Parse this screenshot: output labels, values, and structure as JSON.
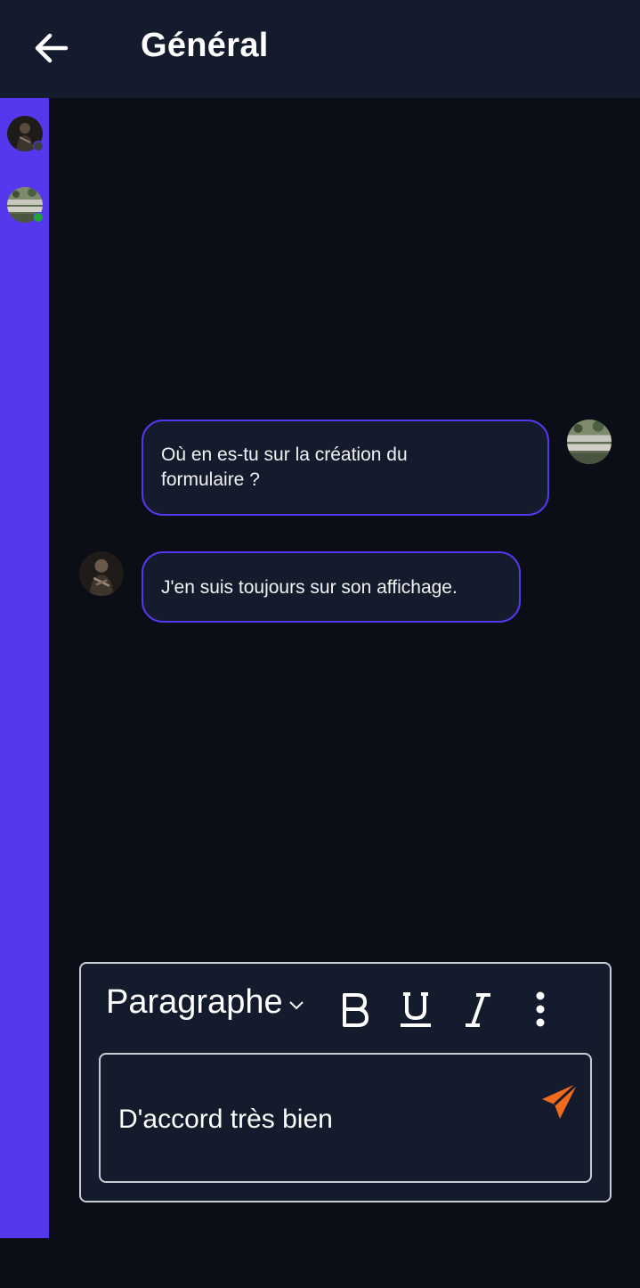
{
  "header": {
    "title": "Général",
    "back_icon": "arrow-left-icon"
  },
  "sidebar": {
    "users": [
      {
        "avatar": "user-photo-dark",
        "status": "offline",
        "status_color": "#3a3f4b"
      },
      {
        "avatar": "user-photo-garden",
        "status": "online",
        "status_color": "#1fa33a"
      }
    ]
  },
  "messages": [
    {
      "side": "right",
      "avatar": "user-photo-garden",
      "text_lines": [
        "Où en es-tu sur la création du",
        "formulaire ?"
      ]
    },
    {
      "side": "left",
      "avatar": "user-photo-dark",
      "text": "J'en suis toujours sur son affichage."
    }
  ],
  "composer": {
    "style_select": "Paragraphe",
    "bold_icon": "bold-icon",
    "underline_icon": "underline-icon",
    "italic_icon": "italic-icon",
    "more_icon": "more-vertical-icon",
    "input_value": "D'accord très bien",
    "send_icon": "send-icon"
  },
  "colors": {
    "accent": "#5538ee",
    "send": "#f26b1d",
    "header_bg": "#141b2d",
    "page_bg": "#0b0e17"
  }
}
